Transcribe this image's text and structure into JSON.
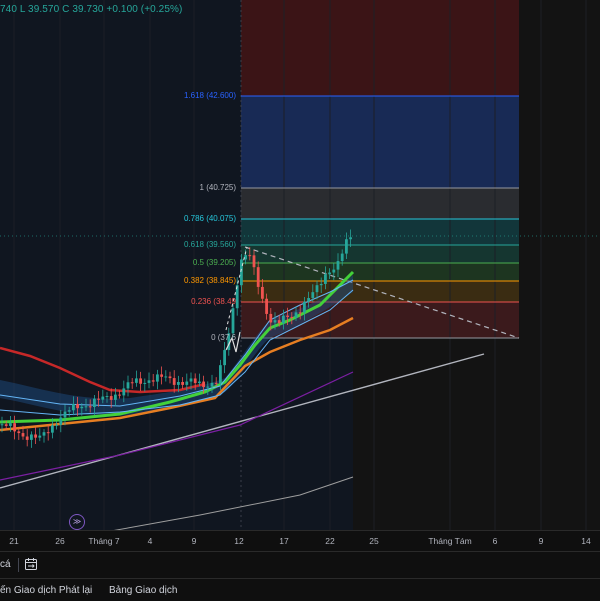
{
  "ohlc": {
    "o_partial": "740",
    "low": "L 39.570",
    "close": "C 39.730",
    "change": "+0.100 (+0.25%)"
  },
  "fib_levels": [
    {
      "label": "1.618 (42.600)",
      "color": "#2962ff"
    },
    {
      "label": "1 (40.725)",
      "color": "#b2b5be"
    },
    {
      "label": "0.786 (40.075)",
      "color": "#26c6da"
    },
    {
      "label": "0.618 (39.560)",
      "color": "#26a69a"
    },
    {
      "label": "0.5 (39.205)",
      "color": "#4caf50"
    },
    {
      "label": "0.382 (38.845)",
      "color": "#ff9800"
    },
    {
      "label": "0.236 (38.49",
      "color": "#ef5350"
    },
    {
      "label": "0 (37.6",
      "color": "#b2b5be"
    }
  ],
  "time_axis": [
    "21",
    "26",
    "Tháng 7",
    "4",
    "9",
    "12",
    "17",
    "22",
    "25",
    "Tháng Tám",
    "6",
    "9",
    "14"
  ],
  "toolbar": {
    "left_text": "cá",
    "calendar_icon": "calendar-range-icon"
  },
  "bottom_tabs": [
    "ến Giao dịch Phát lại",
    "Bảng Giao dịch"
  ],
  "replay_icon": "replay-icon",
  "colors": {
    "up": "#26a69a",
    "down": "#ef5350",
    "fib_zone_top": "#7f1d1d",
    "fib_blue": "#1e3a8a"
  }
}
